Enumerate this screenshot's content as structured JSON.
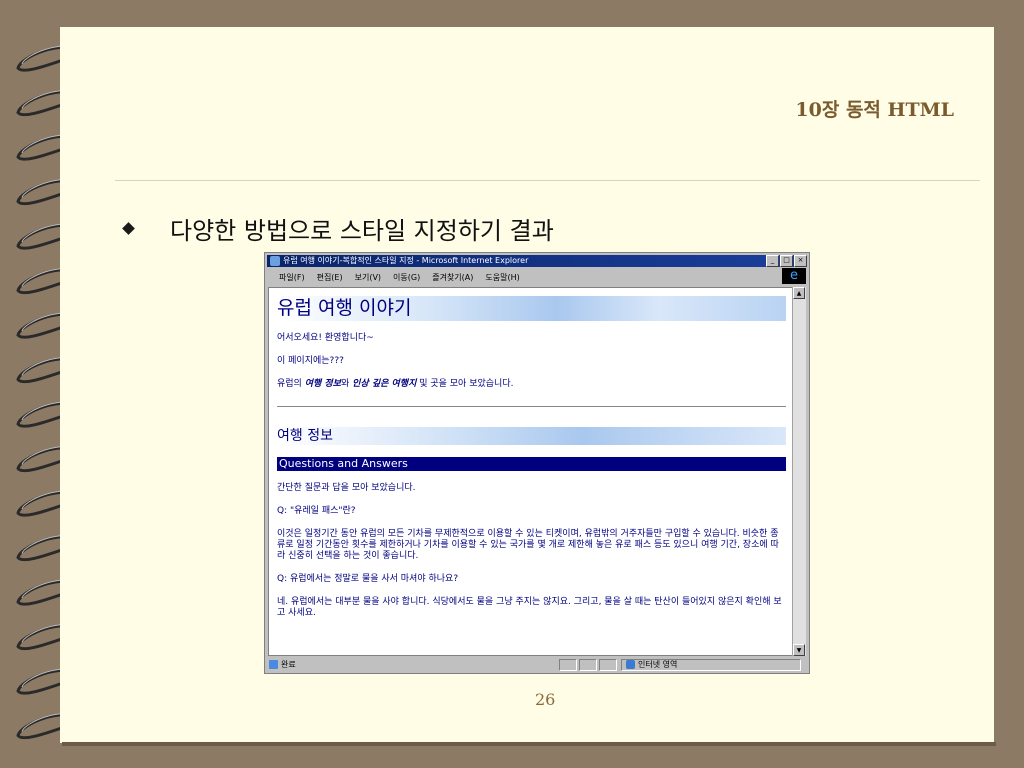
{
  "slide": {
    "header_title": "10장 동적 HTML",
    "bullet_text": "다양한 방법으로 스타일 지정하기 결과",
    "page_number": "26"
  },
  "browser": {
    "title": "유럽 여행 이야기-복합적인 스타일 지정 - Microsoft Internet Explorer",
    "window_buttons": [
      "_",
      "□",
      "×"
    ],
    "menu": [
      "파일(F)",
      "편집(E)",
      "보기(V)",
      "이동(G)",
      "즐겨찾기(A)",
      "도움말(H)"
    ],
    "status_text": "완료",
    "status_zone": "인터넷 영역"
  },
  "webpage": {
    "h1": "유럽 여행 이야기",
    "welcome": "어서오세요! 환영합니다~",
    "intro": "이 페이지에는???",
    "line3": {
      "prefix": "유럽의 ",
      "em1": "여행 정보",
      "mid": "와 ",
      "em2": "인상 깊은 여행지",
      "suffix": " 및 곳을 모아 보았습니다."
    },
    "h2": "여행 정보",
    "qa_heading": "Questions and Answers",
    "qa_intro": "간단한 질문과 답을 모아 보았습니다.",
    "q1": "Q: \"유레일 패스\"란?",
    "a1": "이것은 일정기간 동안 유럽의 모든 기차를 무제한적으로 이용할 수 있는 티켓이며, 유럽밖의 거주자들만 구입할 수 있습니다. 비슷한 종류로 일정 기간동안 횟수를 제한하거나 기차를 이용할 수 있는 국가를 몇 개로 제한해 놓은 유로 패스 등도 있으니 여행 기간, 장소에 따라 신중히 선택을 하는 것이 좋습니다.",
    "q2": "Q: 유럽에서는 정말로 물을 사서 마셔야 하나요?",
    "a2": "네. 유럽에서는 대부분 물을 사야 합니다. 식당에서도 물을 그냥 주지는 않지요. 그리고, 물을 살 때는 탄산이 들어있지 않은지 확인해 보고 사세요."
  },
  "colors": {
    "heading_blue": "#000080",
    "page_bg": "#fffde6",
    "desk_bg": "#8c7a64"
  }
}
